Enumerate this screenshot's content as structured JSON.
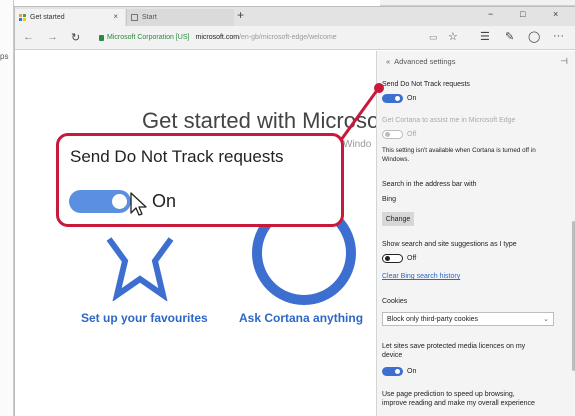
{
  "background": {
    "left_fragment": "ps"
  },
  "tabs": [
    {
      "label": "Get started",
      "active": true
    },
    {
      "label": "Start",
      "active": false
    }
  ],
  "window_controls": {
    "minimize": "−",
    "maximize": "□",
    "close": "×"
  },
  "navbar": {
    "back": "←",
    "forward": "→",
    "refresh": "↻",
    "cert_owner": "Microsoft Corporation [US]",
    "domain": "microsoft.com",
    "path": "/en-gb/microsoft-edge/welcome",
    "reading_view": "📖",
    "favorite": "☆",
    "hub": "☰",
    "note": "✎",
    "share": "◯",
    "more": "···"
  },
  "page": {
    "title": "Get started with Microso",
    "subtitle": "Windo",
    "link_favourites": "Set up your favourites",
    "link_cortana": "Ask Cortana anything"
  },
  "settings": {
    "back_icon": "back-icon",
    "header": "Advanced settings",
    "pin": "⊣",
    "dnt_label": "Send Do Not Track requests",
    "dnt_state": "On",
    "cortana_label": "Get Cortana to assist me in Microsoft Edge",
    "cortana_state": "Off",
    "cortana_note_1": "This setting isn't available when Cortana is turned off in",
    "cortana_note_2": "Windows.",
    "search_label": "Search in the address bar with",
    "search_engine": "Bing",
    "change_button": "Change",
    "suggestions_label": "Show search and site suggestions as I type",
    "suggestions_state": "Off",
    "clear_history_link": "Clear Bing search history",
    "cookies_label": "Cookies",
    "cookies_value": "Block only third-party cookies",
    "media_label_1": "Let sites save protected media licences on my",
    "media_label_2": "device",
    "media_state": "On",
    "prediction_label_1": "Use page prediction to speed up browsing,",
    "prediction_label_2": "improve reading and make my overall experience"
  },
  "callout": {
    "label": "Send Do Not Track requests",
    "state": "On"
  },
  "colors": {
    "accent": "#3d6fd0",
    "callout_border": "#c8193a",
    "link": "#2d67c6",
    "cert_green": "#2b8a3e"
  }
}
